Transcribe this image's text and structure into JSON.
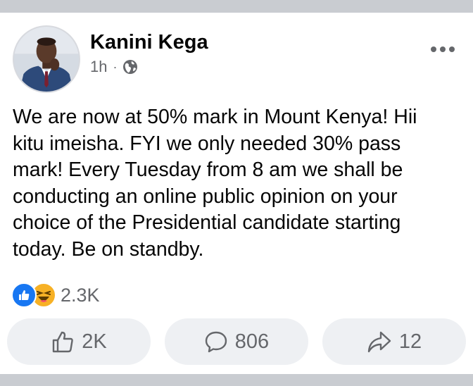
{
  "post": {
    "author": {
      "name": "Kanini Kega",
      "avatar_icon": "profile-photo-icon"
    },
    "time": "1h",
    "separator": "·",
    "privacy_icon": "globe-icon",
    "more_icon": "more-options-icon",
    "text": "We are now at 50% mark in Mount Kenya! Hii\nkitu imeisha. FYI we only needed 30% pass\nmark! Every Tuesday from 8 am we shall be\nconducting an online  public opinion on your\nchoice of the Presidential candidate starting\ntoday. Be on standby.",
    "reactions": {
      "icons": [
        "like-reaction-icon",
        "haha-reaction-icon"
      ],
      "count": "2.3K"
    },
    "actions": {
      "like": {
        "icon": "thumbs-up-icon",
        "label": "2K"
      },
      "comment": {
        "icon": "comment-icon",
        "label": "806"
      },
      "share": {
        "icon": "share-icon",
        "label": "12"
      }
    }
  },
  "colors": {
    "background": "#ffffff",
    "divider": "#c9ccd1",
    "button_bg": "#eef0f3",
    "secondary_text": "#65676b",
    "like_blue": "#1877f2",
    "haha_yellow": "#f7b125"
  }
}
